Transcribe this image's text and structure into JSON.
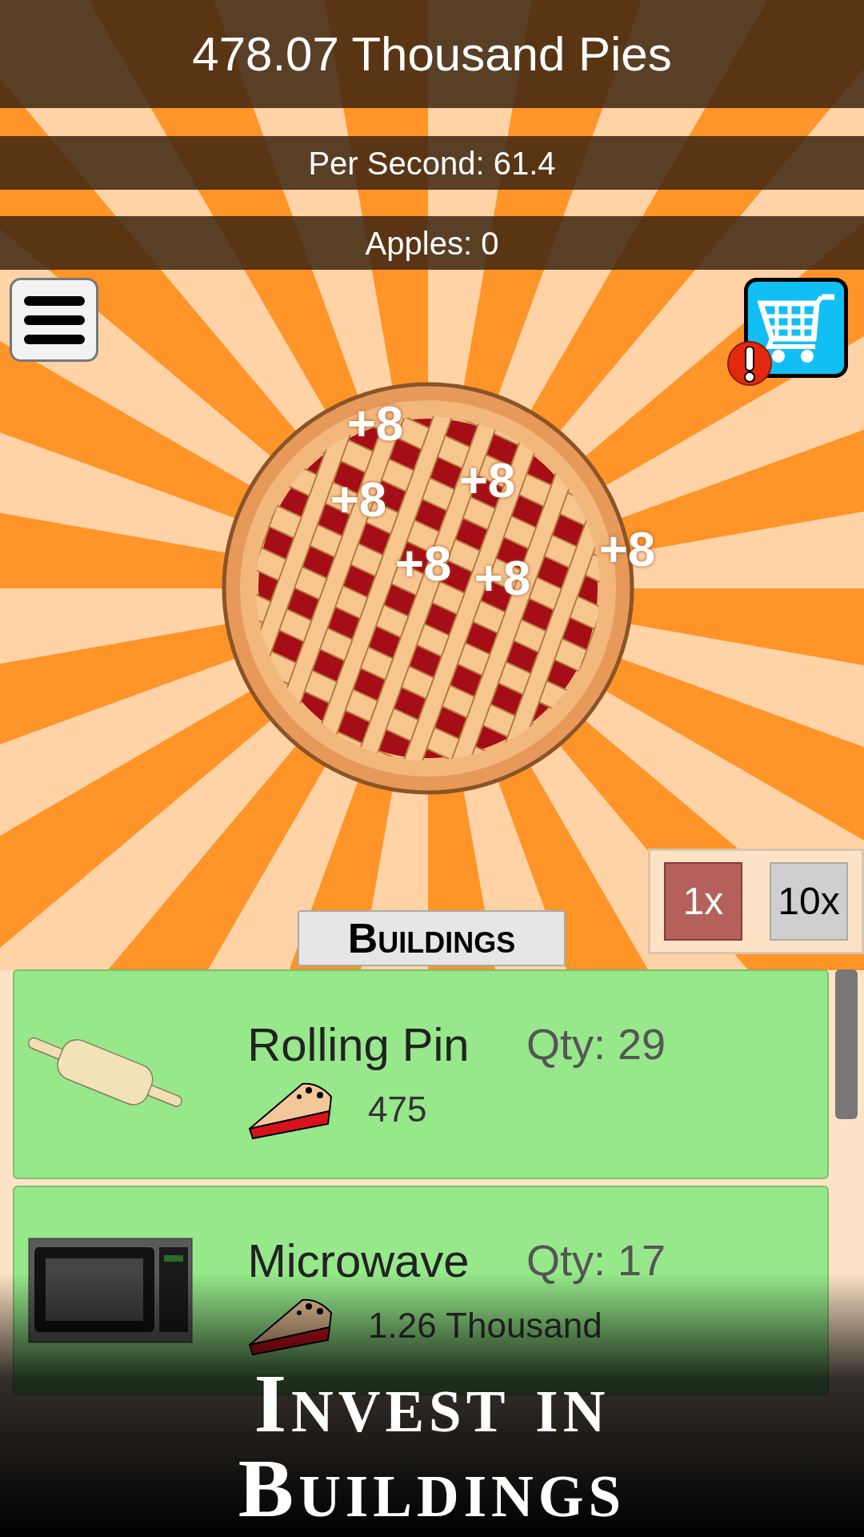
{
  "header": {
    "total": "478.07 Thousand Pies",
    "per_second": "Per Second: 61.4",
    "apples": "Apples: 0"
  },
  "shop": {
    "alert": true
  },
  "clicks": [
    "+8",
    "+8",
    "+8",
    "+8",
    "+8",
    "+8"
  ],
  "multipliers": [
    {
      "label": "1x",
      "selected": true
    },
    {
      "label": "10x",
      "selected": false
    }
  ],
  "tab": {
    "label": "Buildings"
  },
  "buildings": [
    {
      "kind": "rolling_pin",
      "name": "Rolling Pin",
      "qty": "Qty: 29",
      "cost": "475"
    },
    {
      "kind": "microwave",
      "name": "Microwave",
      "qty": "Qty: 17",
      "cost": "1.26 Thousand"
    }
  ],
  "caption": "Invest in Buildings"
}
